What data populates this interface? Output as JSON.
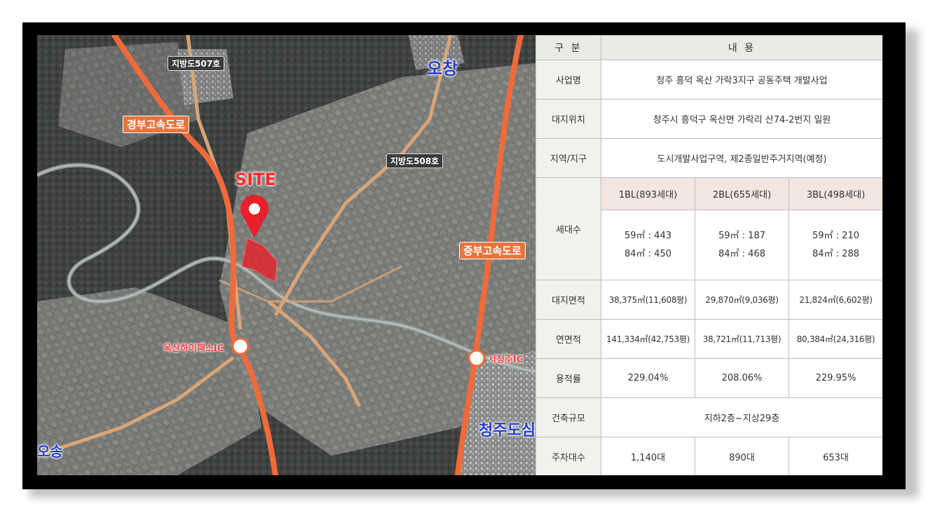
{
  "map": {
    "site_label": "SITE",
    "places": {
      "ochang": "오창",
      "osong": "오송",
      "cheongju": "청주도심"
    },
    "road_labels": {
      "gyeongbu": "경부고속도로",
      "jungbu": "중부고속도로",
      "local507": "지방도507호",
      "local508": "지방도508호"
    },
    "ic_labels": {
      "oksan": "옥산하이패스IC",
      "seocheongju": "서청주IC"
    },
    "colors": {
      "road": "#f06a3a",
      "site": "#e8202a",
      "place": "#2840c8"
    }
  },
  "table": {
    "header": {
      "col1": "구 분",
      "col2": "내 용"
    },
    "business_name": {
      "label": "사업명",
      "value": "청주 흥덕 옥산 가락3지구 공동주택 개발사업"
    },
    "location": {
      "label": "대지위치",
      "value": "청주시 흥덕구 옥산면 가락리 산74-2번지 일원"
    },
    "zone": {
      "label": "지역/지구",
      "value": "도시개발사업구역, 제2종일반주거지역(예정)"
    },
    "households": {
      "label": "세대수",
      "blocks": [
        {
          "name": "1BL(893세대)",
          "line1": "59㎡ : 443",
          "line2": "84㎡ : 450"
        },
        {
          "name": "2BL(655세대)",
          "line1": "59㎡ : 187",
          "line2": "84㎡ : 468"
        },
        {
          "name": "3BL(498세대)",
          "line1": "59㎡ : 210",
          "line2": "84㎡ : 288"
        }
      ]
    },
    "site_area": {
      "label": "대지면적",
      "values": [
        "38,375㎡(11,608평)",
        "29,870㎡(9,036평)",
        "21,824㎡(6,602평)"
      ]
    },
    "floor_area": {
      "label": "연면적",
      "values": [
        "141,334㎡(42,753평)",
        "38,721㎡(11,713평)",
        "80,384㎡(24,316평)"
      ]
    },
    "far": {
      "label": "용적률",
      "values": [
        "229.04%",
        "208.06%",
        "229.95%"
      ]
    },
    "scale": {
      "label": "건축규모",
      "value": "지하2층~지상29층"
    },
    "parking": {
      "label": "주차대수",
      "values": [
        "1,140대",
        "890대",
        "653대"
      ]
    }
  }
}
